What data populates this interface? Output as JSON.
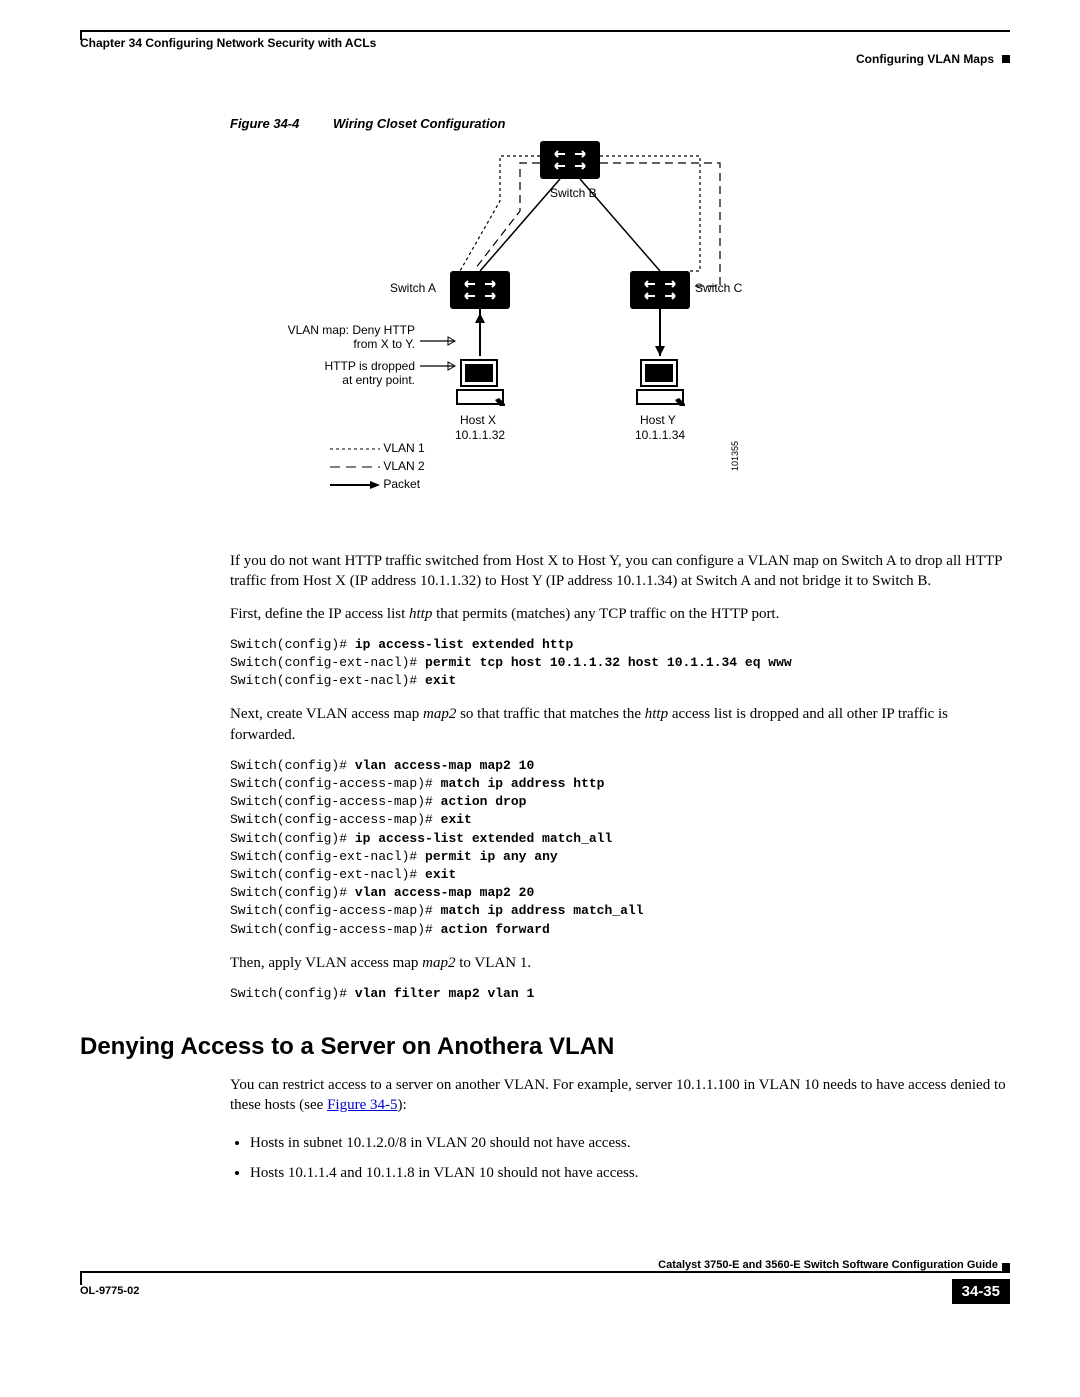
{
  "header": {
    "chapter": "Chapter 34      Configuring Network Security with ACLs",
    "section": "Configuring VLAN Maps"
  },
  "figure": {
    "number": "Figure 34-4",
    "title": "Wiring Closet Configuration",
    "switch_b": "Switch B",
    "switch_a": "Switch A",
    "switch_c": "Switch C",
    "host_x": "Host X",
    "host_x_ip": "10.1.1.32",
    "host_y": "Host Y",
    "host_y_ip": "10.1.1.34",
    "vlan_map_line1": "VLAN map: Deny HTTP",
    "vlan_map_line2": "from X to Y.",
    "http_drop_line1": "HTTP is dropped",
    "http_drop_line2": "at entry point.",
    "legend_vlan1": "VLAN 1",
    "legend_vlan2": "VLAN 2",
    "legend_packet": "Packet",
    "sidecode": "101355"
  },
  "para1_a": "If you do not want HTTP traffic switched from Host X to Host Y, you can configure a VLAN map on Switch A to drop all HTTP traffic from Host X (IP address 10.1.1.32) to Host Y (IP address 10.1.1.34) at Switch A and not bridge it to Switch B.",
  "para1_b_pre": "First, define the IP access list ",
  "para1_b_em": "http",
  "para1_b_post": " that permits (matches) any TCP traffic on the HTTP port.",
  "code1": {
    "l1a": "Switch(config)# ",
    "l1b": "ip access-list extended http",
    "l2a": "Switch(config-ext-nacl)# ",
    "l2b": "permit tcp host 10.1.1.32 host 10.1.1.34 eq www",
    "l3a": "Switch(config-ext-nacl)# ",
    "l3b": "exit"
  },
  "para2_pre": "Next, create VLAN access map ",
  "para2_em1": "map2",
  "para2_mid": " so that traffic that matches the ",
  "para2_em2": "http",
  "para2_post": " access list is dropped and all other IP traffic is forwarded.",
  "code2": {
    "l1a": "Switch(config)# ",
    "l1b": "vlan access-map map2 10",
    "l2a": "Switch(config-access-map)# ",
    "l2b": "match ip address http",
    "l3a": "Switch(config-access-map)# ",
    "l3b": "action drop",
    "l4a": "Switch(config-access-map)# ",
    "l4b": "exit",
    "l5a": "Switch(config)# ",
    "l5b": "ip access-list extended match_all",
    "l6a": "Switch(config-ext-nacl)# ",
    "l6b": "permit ip any any",
    "l7a": "Switch(config-ext-nacl)# ",
    "l7b": "exit",
    "l8a": "Switch(config)# ",
    "l8b": "vlan access-map map2 20",
    "l9a": "Switch(config-access-map)# ",
    "l9b": "match ip address match_all",
    "l10a": "Switch(config-access-map)# ",
    "l10b": "action forward"
  },
  "para3_pre": "Then, apply VLAN access map ",
  "para3_em": "map2",
  "para3_post": " to VLAN 1.",
  "code3": {
    "l1a": "Switch(config)# ",
    "l1b": "vlan filter map2 vlan 1"
  },
  "h2": "Denying Access to a Server on Anothera VLAN",
  "para4_pre": "You can restrict access to a server on another VLAN. For example, server 10.1.1.100 in VLAN 10 needs to have access denied to these hosts (see ",
  "para4_link": "Figure 34-5",
  "para4_post": "):",
  "bullets": {
    "b1": "Hosts in subnet 10.1.2.0/8 in VLAN 20 should not have access.",
    "b2": "Hosts 10.1.1.4 and 10.1.1.8 in VLAN 10 should not have access."
  },
  "footer": {
    "guide": "Catalyst 3750-E and 3560-E Switch Software Configuration Guide",
    "doc": "OL-9775-02",
    "page": "34-35"
  }
}
